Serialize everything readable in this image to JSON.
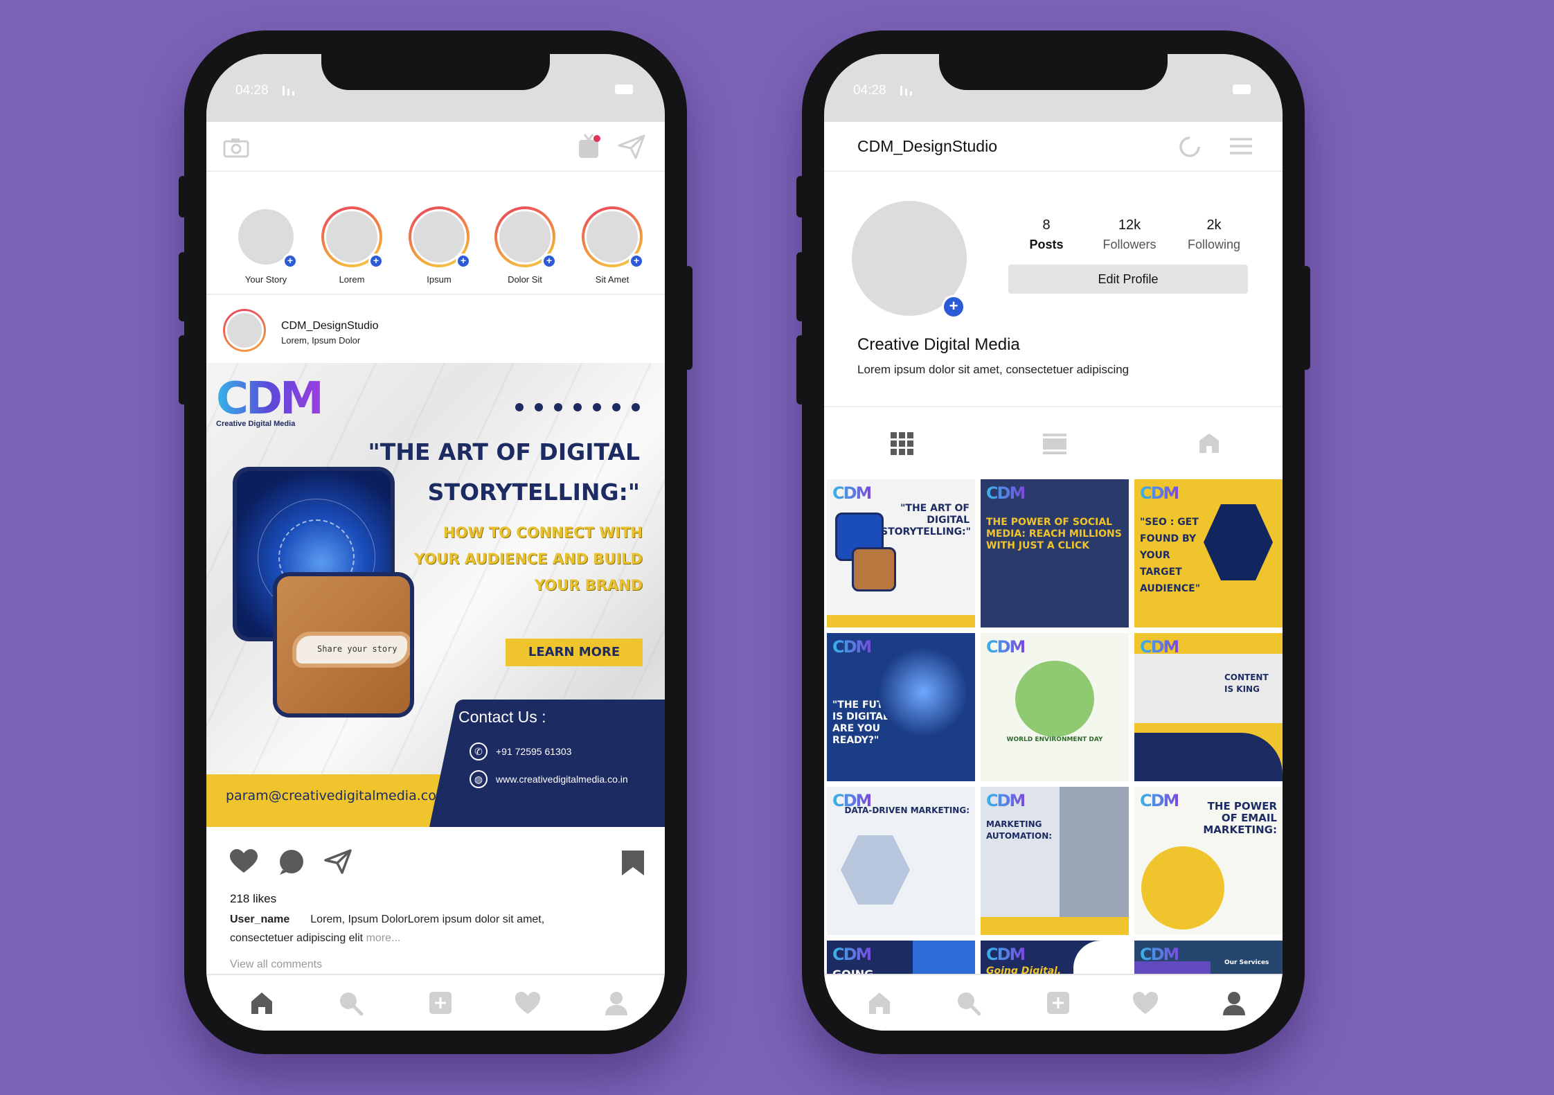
{
  "colors": {
    "background": "#7b62b6",
    "navy": "#1d2b63",
    "yellow": "#f0c42c",
    "accent_blue": "#2d5bd7",
    "placeholder": "#dcdcdc"
  },
  "feed": {
    "status": {
      "time": "04:28"
    },
    "topbar": {
      "left_icon": "camera-icon",
      "right_icons": [
        "igtv-icon",
        "direct-message-icon"
      ]
    },
    "stories": [
      {
        "label": "Your Story",
        "own": true
      },
      {
        "label": "Lorem"
      },
      {
        "label": "Ipsum"
      },
      {
        "label": "Dolor Sit"
      },
      {
        "label": "Sit Amet"
      }
    ],
    "post": {
      "username": "CDM_DesignStudio",
      "location": "Lorem, Ipsum Dolor",
      "creative": {
        "logo": "CDM",
        "logo_sub": "Creative Digital Media",
        "headline_1": "\"THE ART OF DIGITAL",
        "headline_2": "STORYTELLING:\"",
        "sub_1": "HOW TO CONNECT WITH",
        "sub_2": "YOUR AUDIENCE AND BUILD",
        "sub_3": "YOUR BRAND",
        "paper_text": "Share your story",
        "cta": "LEARN MORE",
        "contact_title": "Contact Us :",
        "phone": "+91 72595 61303",
        "website": "www.creativedigitalmedia.co.in",
        "email": "param@creativedigitalmedia.co.in"
      },
      "likes": "218 likes",
      "caption_user": "User_name",
      "caption_text": "Lorem, Ipsum DolorLorem ipsum dolor sit amet, consectetuer adipiscing elit",
      "more": "more...",
      "view_all": "View all comments"
    }
  },
  "profile": {
    "status": {
      "time": "04:28"
    },
    "username": "CDM_DesignStudio",
    "stats": [
      {
        "value": "8",
        "label": "Posts"
      },
      {
        "value": "12k",
        "label": "Followers"
      },
      {
        "value": "2k",
        "label": "Following"
      }
    ],
    "edit_button": "Edit Profile",
    "display_name": "Creative Digital Media",
    "bio": "Lorem ipsum dolor sit amet, consectetuer adipiscing",
    "grid": [
      {
        "title": "\"THE ART OF DIGITAL STORYTELLING:\"",
        "bg": "#f3f3f3",
        "fg": "#1d2b63"
      },
      {
        "title": "THE POWER OF SOCIAL MEDIA: REACH MILLIONS WITH JUST A CLICK",
        "bg": "#2a3a6a",
        "fg": "#f0c42c"
      },
      {
        "title": "\"SEO : GET FOUND BY YOUR TARGET AUDIENCE\"",
        "bg": "#f0c42c",
        "fg": "#1d2b63"
      },
      {
        "title": "\"THE FUTURE IS DIGITAL: ARE YOU READY?\"",
        "bg": "#1b3d86",
        "fg": "#ffffff"
      },
      {
        "title": "WORLD ENVIRONMENT DAY",
        "bg": "#f4f7ee",
        "fg": "#2f6b2a"
      },
      {
        "title": "CONTENT IS KING",
        "bg": "#f0c42c",
        "fg": "#1d2b63"
      },
      {
        "title": "DATA-DRIVEN MARKETING:",
        "bg": "#eef2f7",
        "fg": "#1d2b63"
      },
      {
        "title": "MARKETING AUTOMATION:",
        "bg": "#dfe4ec",
        "fg": "#1d2b63"
      },
      {
        "title": "THE POWER OF EMAIL MARKETING:",
        "bg": "#f7f7f2",
        "fg": "#1d2b63"
      },
      {
        "title": "GOING MOBILE:",
        "bg": "#1d2b63",
        "fg": "#ffffff"
      },
      {
        "title": "Going Digital, Going Global:",
        "bg": "#1d2b63",
        "fg": "#f0c42c"
      },
      {
        "title": "Our Services",
        "bg": "#27466f",
        "fg": "#ffffff"
      }
    ]
  }
}
